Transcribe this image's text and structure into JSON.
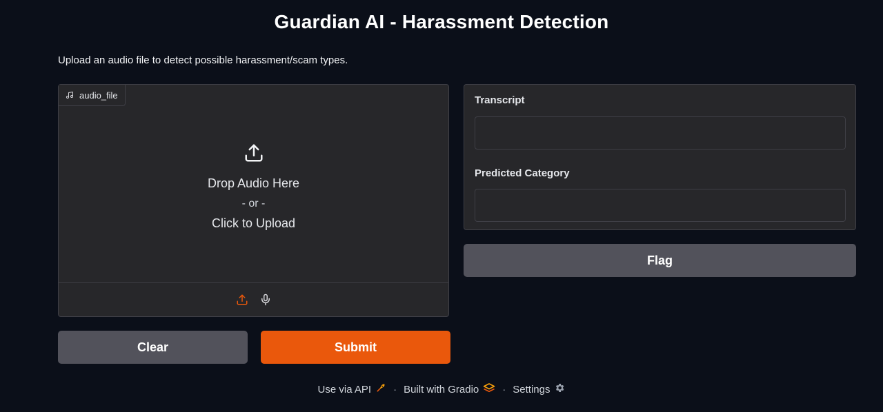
{
  "app": {
    "title": "Guardian AI - Harassment Detection",
    "description": "Upload an audio file to detect possible harassment/scam types."
  },
  "input": {
    "label": "audio_file",
    "drop_text": "Drop Audio Here",
    "or_text": "- or -",
    "click_text": "Click to Upload",
    "sources": [
      "upload-icon",
      "microphone-icon"
    ]
  },
  "outputs": {
    "transcript_label": "Transcript",
    "transcript_value": "",
    "category_label": "Predicted Category",
    "category_value": ""
  },
  "buttons": {
    "clear": "Clear",
    "submit": "Submit",
    "flag": "Flag"
  },
  "footer": {
    "api": "Use via API",
    "built": "Built with Gradio",
    "settings": "Settings",
    "separator": "·"
  },
  "colors": {
    "background": "#0b0f19",
    "panel": "#27272a",
    "border": "#3f3f46",
    "primary": "#ea580c",
    "secondary": "#52525b"
  }
}
